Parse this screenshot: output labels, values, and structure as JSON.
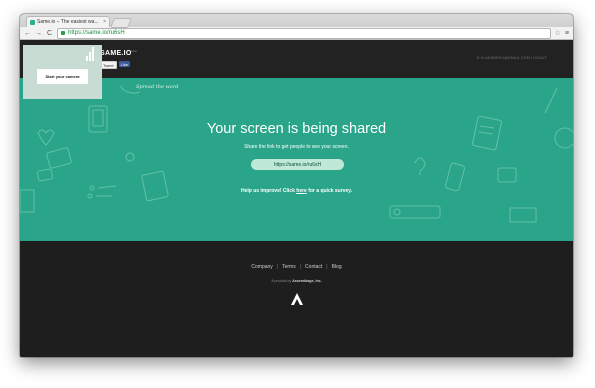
{
  "browser": {
    "tab_title": "Same.io – The easiest wa...",
    "tab_close": "×",
    "back": "←",
    "forward": "→",
    "reload": "C",
    "url": "https://same.io/ru6sH",
    "star": "☆",
    "menu": "≡"
  },
  "header": {
    "camera_button": "Start your camera",
    "logo": "SAME.IO",
    "beta": "beta",
    "tweet": "Tweet",
    "like": "Like",
    "user": "D.VLADIMIROV@GMAIL.COM  LOGOUT"
  },
  "hero": {
    "spread": "Spread the word",
    "headline": "Your screen is being shared",
    "subheadline": "Share the link to get people to see your screen.",
    "share_link": "https://same.io/ru6sH",
    "survey_prefix": "Help us improve! Click ",
    "survey_link": "here",
    "survey_suffix": " for a quick survey."
  },
  "footer": {
    "links": [
      "Company",
      "Terms",
      "Contact",
      "Blog"
    ],
    "separator": "|",
    "product_prefix": "A product by ",
    "product_company": "Assemblage, Inc."
  },
  "colors": {
    "hero_bg": "#2aa58a",
    "dark_bg": "#1e1e1e",
    "pill_bg": "#bfe8d6"
  }
}
